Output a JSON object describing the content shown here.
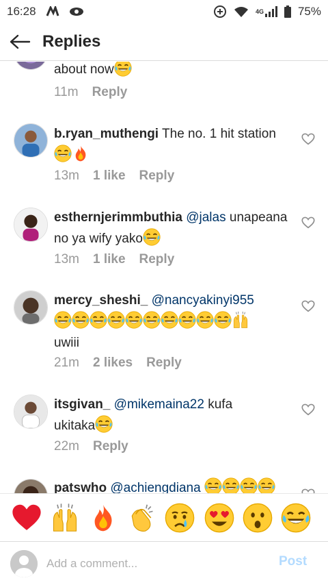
{
  "status_bar": {
    "time": "16:28",
    "network": "4G",
    "battery": "75%"
  },
  "header": {
    "title": "Replies"
  },
  "comments": [
    {
      "text": "about now",
      "time": "11m",
      "reply": "Reply"
    },
    {
      "username": "b.ryan_muthengi",
      "text": "The no. 1 hit station",
      "time": "13m",
      "likes": "1 like",
      "reply": "Reply"
    },
    {
      "username": "esthernjerimmbuthia",
      "mention": "@jalas",
      "text": "unapeana no ya wify yako",
      "time": "13m",
      "likes": "1 like",
      "reply": "Reply"
    },
    {
      "username": "mercy_sheshi_",
      "mention": "@nancyakinyi955",
      "text": "uwiii",
      "time": "21m",
      "likes": "2 likes",
      "reply": "Reply"
    },
    {
      "username": "itsgivan_",
      "mention": "@mikemaina22",
      "text_a": "kufa",
      "text_b": "ukitaka",
      "time": "22m",
      "reply": "Reply"
    },
    {
      "username": "patswho",
      "mention": "@achiengdiana"
    }
  ],
  "reactions": [
    "red-heart",
    "raised-hands",
    "fire",
    "clapping-hands",
    "crying-face",
    "heart-eyes",
    "astonished-face",
    "tears-of-joy"
  ],
  "composer": {
    "placeholder": "Add a comment...",
    "post_label": "Post"
  },
  "colors": {
    "link": "#003569",
    "muted": "#999999",
    "post_disabled": "#b3dbff"
  }
}
